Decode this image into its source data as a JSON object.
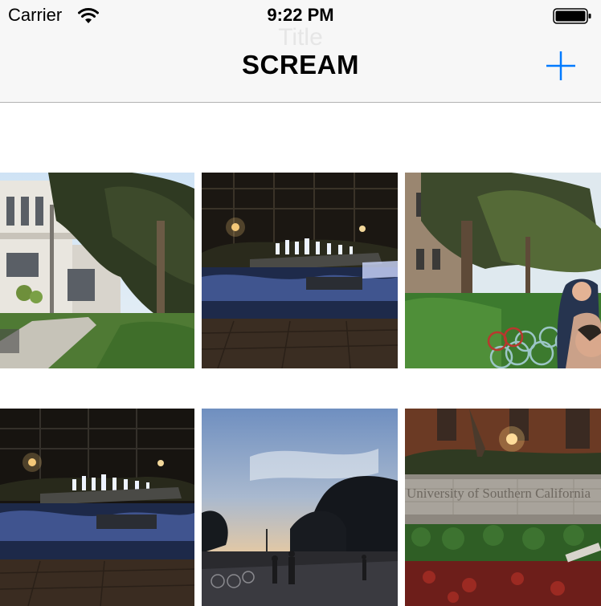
{
  "status_bar": {
    "carrier": "Carrier",
    "time": "9:22 PM",
    "wifi_icon": "wifi-icon",
    "battery_icon": "battery-icon"
  },
  "nav": {
    "ghost_title": "Title",
    "title": "SCREAM",
    "add_icon": "plus-icon",
    "accent_color": "#007aff"
  },
  "photos": [
    {
      "subject": "campus building with trees",
      "label": ""
    },
    {
      "subject": "fountain at night",
      "label": ""
    },
    {
      "subject": "bikes parked by trees",
      "label": ""
    },
    {
      "subject": "fountain at night",
      "label": ""
    },
    {
      "subject": "sunset sky with tree silhouettes",
      "label": ""
    },
    {
      "subject": "University of Southern California sign",
      "label": "University of Southern California"
    }
  ]
}
